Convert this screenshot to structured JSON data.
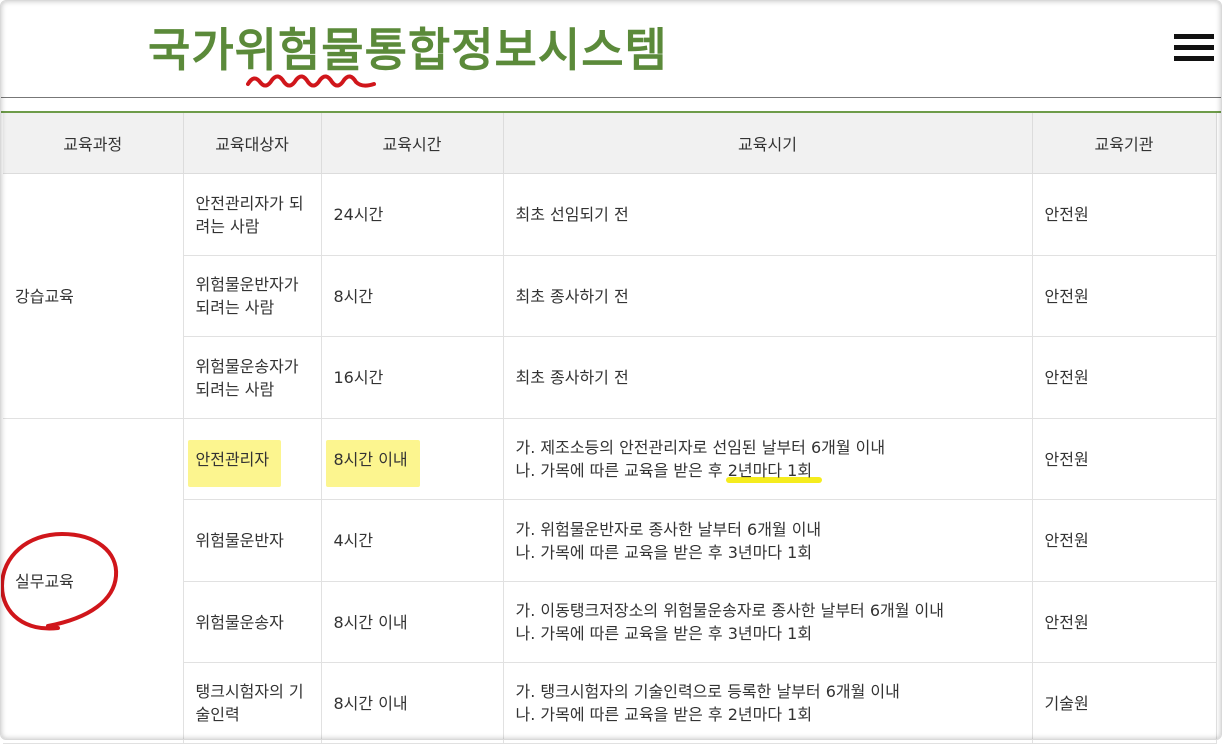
{
  "header": {
    "site_title": "국가위험물통합정보시스템",
    "menu_icon": "hamburger-menu-icon"
  },
  "table": {
    "columns": [
      "교육과정",
      "교육대상자",
      "교육시간",
      "교육시기",
      "교육기관"
    ],
    "groups": [
      {
        "course": "강습교육",
        "rows": [
          {
            "target": "안전관리자가 되려는 사람",
            "hours": "24시간",
            "timing_lines": [
              "최초 선임되기 전"
            ],
            "agency": "안전원"
          },
          {
            "target": "위험물운반자가 되려는 사람",
            "hours": "8시간",
            "timing_lines": [
              "최초 종사하기 전"
            ],
            "agency": "안전원"
          },
          {
            "target": "위험물운송자가 되려는 사람",
            "hours": "16시간",
            "timing_lines": [
              "최초 종사하기 전"
            ],
            "agency": "안전원"
          }
        ]
      },
      {
        "course": "실무교육",
        "rows": [
          {
            "target": "안전관리자",
            "hours": "8시간 이내",
            "timing_lines": [
              "가. 제조소등의 안전관리자로 선임된 날부터 6개월 이내",
              "나. 가목에 따른 교육을 받은 후 2년마다 1회"
            ],
            "agency": "안전원"
          },
          {
            "target": "위험물운반자",
            "hours": "4시간",
            "timing_lines": [
              "가. 위험물운반자로 종사한 날부터 6개월 이내",
              "나. 가목에 따른 교육을 받은 후 3년마다 1회"
            ],
            "agency": "안전원"
          },
          {
            "target": "위험물운송자",
            "hours": "8시간 이내",
            "timing_lines": [
              "가. 이동탱크저장소의 위험물운송자로 종사한 날부터 6개월 이내",
              "나. 가목에 따른 교육을 받은 후 3년마다 1회"
            ],
            "agency": "안전원"
          },
          {
            "target": "탱크시험자의 기술인력",
            "hours": "8시간 이내",
            "timing_lines": [
              "가. 탱크시험자의 기술인력으로 등록한 날부터 6개월 이내",
              "나. 가목에 따른 교육을 받은 후 2년마다 1회"
            ],
            "agency": "기술원"
          }
        ]
      }
    ]
  },
  "annotations": {
    "highlight_color": "#fbf26a",
    "circle_color": "#d0161b",
    "squiggle_color": "#d0161b",
    "underline_prefix": "나. 가목에 따른 교육을 받은 후 ",
    "underline_text": "2년마다 1회"
  }
}
